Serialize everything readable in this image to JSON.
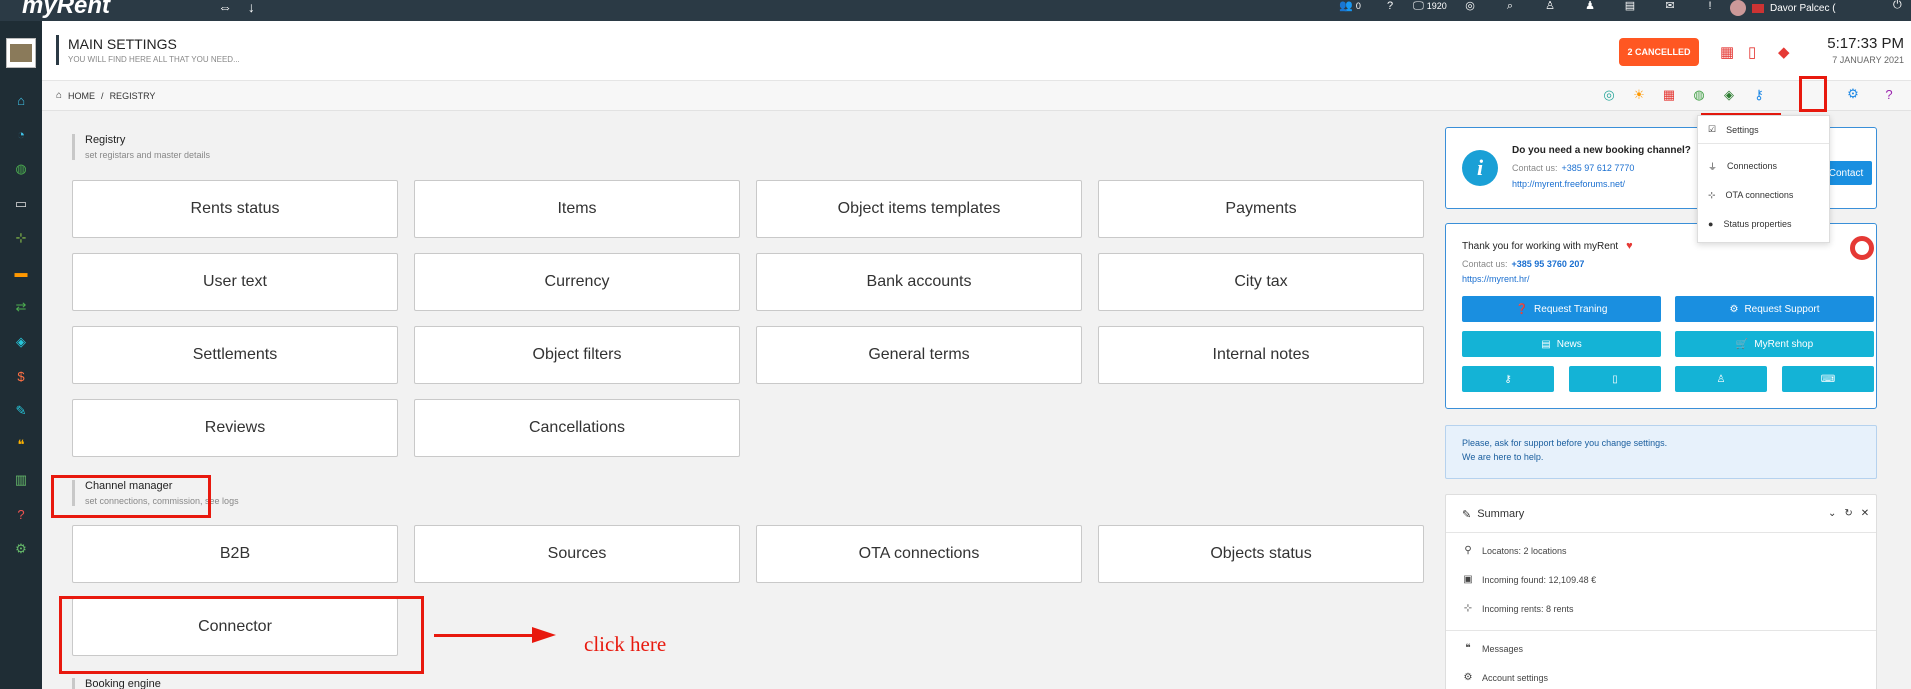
{
  "topbar": {
    "logo": "myRent",
    "arrows": [
      "⇔",
      "↓"
    ],
    "icons": [
      {
        "name": "users-icon",
        "glyph": "👥",
        "count": "0"
      },
      {
        "name": "help-circle-icon",
        "glyph": "?",
        "count": ""
      },
      {
        "name": "monitor-icon",
        "glyph": "🖵",
        "count": "1920"
      },
      {
        "name": "globe-icon",
        "glyph": "◎",
        "count": ""
      },
      {
        "name": "search-icon",
        "glyph": "⌕",
        "count": ""
      },
      {
        "name": "user-icon",
        "glyph": "♙",
        "count": ""
      },
      {
        "name": "user-group-icon",
        "glyph": "♟",
        "count": ""
      },
      {
        "name": "book-icon",
        "glyph": "▤",
        "count": ""
      },
      {
        "name": "chat-icon",
        "glyph": "✉",
        "count": ""
      },
      {
        "name": "info-icon",
        "glyph": "!",
        "count": ""
      }
    ],
    "user_name": "Davor Palcec (",
    "power": "⏻"
  },
  "sidebar": {
    "items": [
      {
        "name": "home",
        "glyph": "⌂",
        "color": "#3fc1e6"
      },
      {
        "name": "dashboard",
        "glyph": "◔",
        "color": "#3fc1e6"
      },
      {
        "name": "globe",
        "glyph": "◍",
        "color": "#4caf50"
      },
      {
        "name": "rooms",
        "glyph": "▭",
        "color": "#dddddd"
      },
      {
        "name": "network",
        "glyph": "⊹",
        "color": "#8bc34a"
      },
      {
        "name": "car",
        "glyph": "▬",
        "color": "#ff9800"
      },
      {
        "name": "transfer",
        "glyph": "⇄",
        "color": "#4caf50"
      },
      {
        "name": "layers",
        "glyph": "◈",
        "color": "#26c6da"
      },
      {
        "name": "user-money",
        "glyph": "$",
        "color": "#ff7043"
      },
      {
        "name": "edit",
        "glyph": "✎",
        "color": "#26c6da"
      },
      {
        "name": "chat",
        "glyph": "❝",
        "color": "#ffb300"
      },
      {
        "name": "chart",
        "glyph": "▥",
        "color": "#66bb6a"
      },
      {
        "name": "help",
        "glyph": "?",
        "color": "#ef5350"
      },
      {
        "name": "settings",
        "glyph": "⚙",
        "color": "#66bb6a"
      }
    ]
  },
  "header": {
    "title": "MAIN SETTINGS",
    "subtitle": "YOU WILL FIND HERE ALL THAT YOU NEED...",
    "cancelled_label": "2 CANCELLED",
    "time": "5:17:33 PM",
    "date": "7 JANUARY 2021"
  },
  "breadcrumb": {
    "home": "HOME",
    "separator": "/",
    "current": "REGISTRY"
  },
  "toolbar_icons": [
    "◎",
    "☀",
    "▦",
    "◍",
    "◈",
    "⚷",
    "⚙",
    "?",
    "⇲"
  ],
  "registry": {
    "title": "Registry",
    "subtitle": "set registars and master details",
    "tiles": [
      "Rents status",
      "Items",
      "Object items templates",
      "Payments",
      "User text",
      "Currency",
      "Bank accounts",
      "City tax",
      "Settlements",
      "Object filters",
      "General terms",
      "Internal notes",
      "Reviews",
      "Cancellations"
    ]
  },
  "channel_manager": {
    "title": "Channel manager",
    "subtitle": "set connections, commission, see logs",
    "tiles": [
      "B2B",
      "Sources",
      "OTA connections",
      "Objects status",
      "Connector"
    ]
  },
  "booking_engine": {
    "title": "Booking engine"
  },
  "annotation": {
    "click_here": "click here"
  },
  "dropdown": {
    "items": [
      "Settings",
      "Connections",
      "OTA connections",
      "Status properties"
    ]
  },
  "panel_channel": {
    "question": "Do you need a new booking channel?",
    "contact_label": "Contact us:",
    "phone": "+385 97 612 7770",
    "url": "http://myrent.freeforums.net/",
    "button": "Contact"
  },
  "panel_thanks": {
    "title": "Thank you for working with myRent",
    "contact_label": "Contact us:",
    "phone": "+385 95 3760 207",
    "url": "https://myrent.hr/",
    "buttons": {
      "request_training": "Request Traning",
      "request_support": "Request Support",
      "news": "News",
      "shop": "MyRent shop"
    }
  },
  "support_note": {
    "line1": "Please, ask for support before you change settings.",
    "line2": "We are here to help."
  },
  "summary": {
    "title": "Summary",
    "locations": "Locatons: 2 locations",
    "incoming_found": "Incoming found:  12,109.48  €",
    "incoming_rents": "Incoming rents: 8 rents",
    "messages": "Messages",
    "account_settings": "Account settings"
  },
  "colors": {
    "accent_red": "#e8190e",
    "cancel_orange": "#ff5722",
    "button_blue": "#1a8fe0",
    "button_cyan": "#14b3d6",
    "sidebar_dark": "#1f2d35"
  }
}
